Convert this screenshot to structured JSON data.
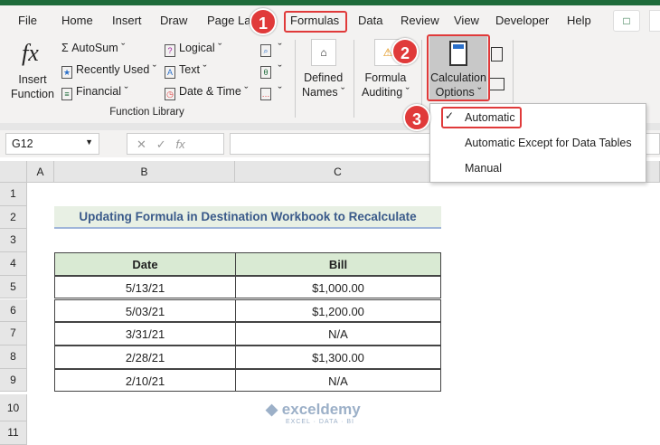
{
  "menu": {
    "tabs": [
      "File",
      "Home",
      "Insert",
      "Draw",
      "Page Layout",
      "Formulas",
      "Data",
      "Review",
      "View",
      "Developer",
      "Help"
    ]
  },
  "ribbon": {
    "insert_function": [
      "Insert",
      "Function"
    ],
    "autosum": "AutoSum",
    "recently_used": "Recently Used",
    "financial": "Financial",
    "logical": "Logical",
    "text": "Text",
    "date_time": "Date & Time",
    "group_label": "Function Library",
    "defined_names": [
      "Defined",
      "Names"
    ],
    "formula_auditing": [
      "Formula",
      "Auditing"
    ],
    "calc_options": [
      "Calculation",
      "Options"
    ]
  },
  "calc_menu": {
    "items": [
      "Automatic",
      "Automatic Except for Data Tables",
      "Manual"
    ],
    "checked": "Automatic"
  },
  "badges": [
    "1",
    "2",
    "3"
  ],
  "formula_bar": {
    "name_box": "G12",
    "fx": "fx",
    "value": ""
  },
  "columns": [
    "A",
    "B",
    "C"
  ],
  "rows": [
    "1",
    "2",
    "3",
    "4",
    "5",
    "6",
    "7",
    "8",
    "9",
    "10",
    "11"
  ],
  "sheet": {
    "title": "Updating Formula in Destination Workbook to Recalculate",
    "headers": [
      "Date",
      "Bill"
    ],
    "data": [
      [
        "5/13/21",
        "$1,000.00"
      ],
      [
        "5/03/21",
        "$1,200.00"
      ],
      [
        "3/31/21",
        "N/A"
      ],
      [
        "2/28/21",
        "$1,300.00"
      ],
      [
        "2/10/21",
        "N/A"
      ]
    ]
  },
  "watermark": {
    "name": "exceldemy",
    "tagline": "EXCEL · DATA · BI"
  },
  "colors": {
    "accent": "#1e6b3a",
    "highlight": "#e03a3a",
    "header_fill": "#d9ead3"
  }
}
